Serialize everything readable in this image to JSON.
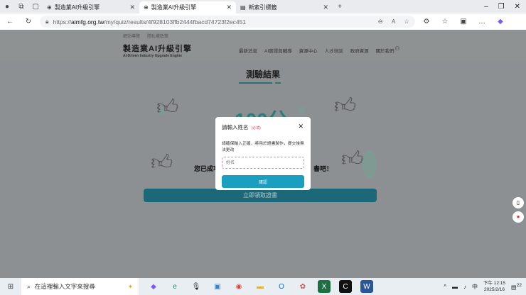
{
  "browser": {
    "tabs": [
      {
        "title": "製造業AI升級引擎",
        "active": false
      },
      {
        "title": "製造業AI升級引擎",
        "active": true
      },
      {
        "title": "新索引標籤",
        "active": false
      }
    ],
    "url_prefix": "https://",
    "url_domain": "aimfg.org.tw",
    "url_path": "/my/quiz/results/4f928103ffb2444fbacd74723f2ec451"
  },
  "site": {
    "top_links": [
      "網站導覽",
      "隱私權政策"
    ],
    "logo_title": "製造業AI升級引擎",
    "logo_subtitle": "AI-Driven Industry Upgrade Engine",
    "nav": [
      "最新消息",
      "AI實證與輔導",
      "資源中心",
      "人才培訓",
      "政府資源",
      "關於我們"
    ]
  },
  "main": {
    "page_title": "測驗結果",
    "score": "100分",
    "message_start": "您已成功",
    "message_end": "書吧！",
    "claim_button": "立即領取證書"
  },
  "modal": {
    "title": "請輸入姓名",
    "required": "(必填)",
    "description": "請確保輸入正確，將用於證書製作，提交後無法更改",
    "input_placeholder": "姓名",
    "input_value": "",
    "confirm_button": "確認"
  },
  "taskbar": {
    "search_placeholder": "在這裡輸入文字來搜尋",
    "ime": "中",
    "time": "下午 12:15",
    "date": "2025/2/16",
    "notifications": "22"
  }
}
